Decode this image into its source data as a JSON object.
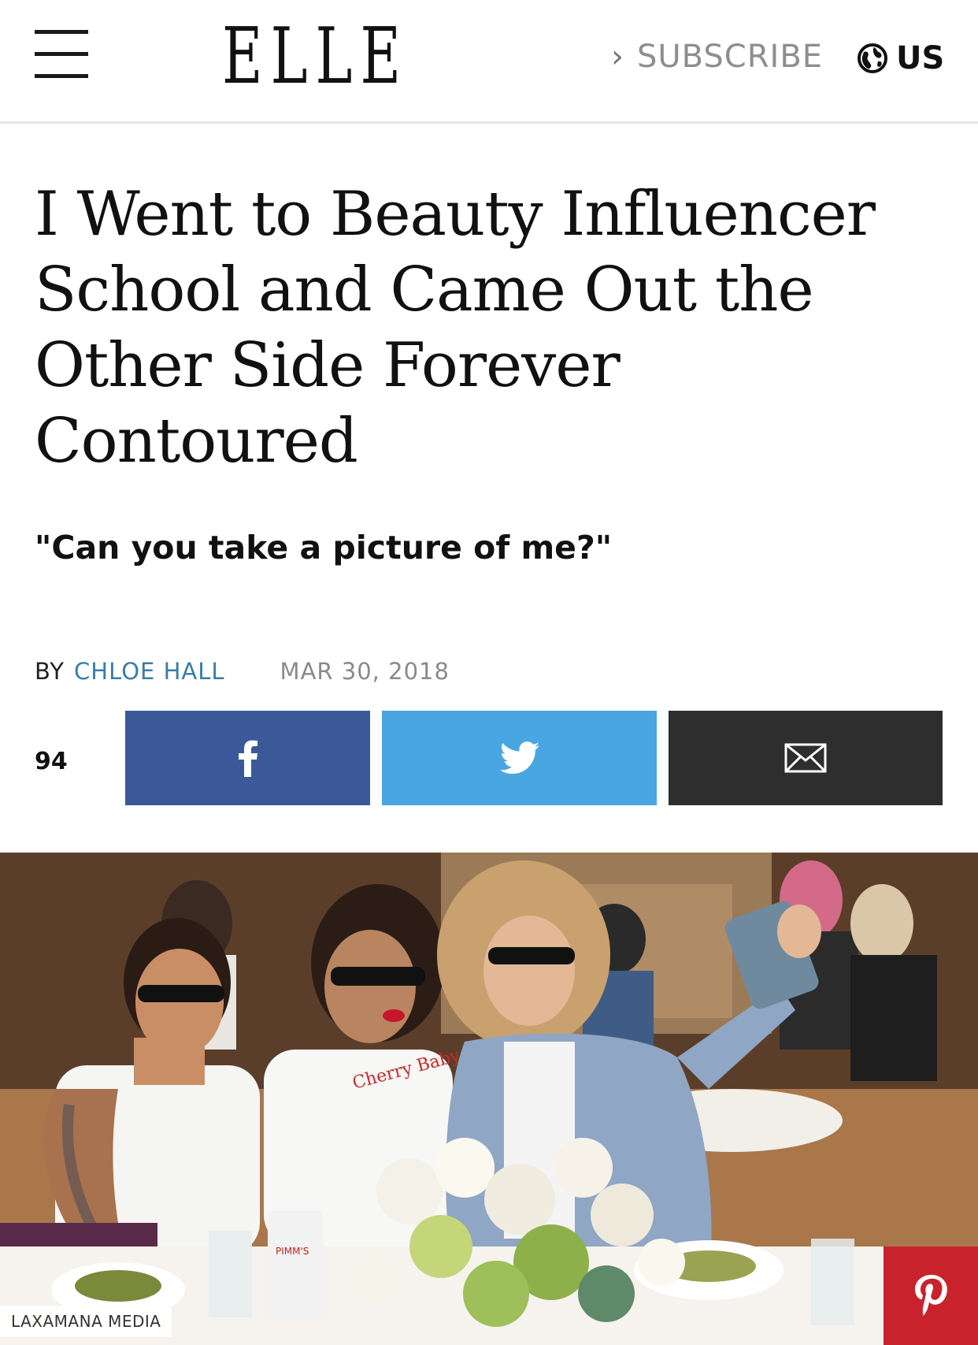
{
  "header": {
    "logo_text": "ELLE",
    "subscribe_label": "SUBSCRIBE",
    "region_label": "US",
    "icons": {
      "menu": "hamburger-icon",
      "chevron": "chevron-right-icon",
      "globe": "globe-icon"
    }
  },
  "article": {
    "headline": "I Went to Beauty Influencer School and Came Out the Other Side Forever Contoured",
    "dek": "\"Can you take a picture of me?\"",
    "byline_prefix": "BY",
    "author": "CHLOE HALL",
    "date": "MAR 30, 2018"
  },
  "share": {
    "count": "94",
    "buttons": [
      {
        "network": "facebook",
        "icon": "facebook-icon",
        "color": "#3b5998"
      },
      {
        "network": "twitter",
        "icon": "twitter-icon",
        "color": "#4aa6e2"
      },
      {
        "network": "email",
        "icon": "mail-icon",
        "color": "#2e2e2e"
      }
    ]
  },
  "hero": {
    "photo_credit": "LAXAMANA MEDIA",
    "shirt_text": "Cherry Baby",
    "cup_text": "PIMM'S",
    "pin_icon": "pinterest-icon",
    "pin_color": "#c8232c"
  },
  "colors": {
    "author_link": "#3a7ca5",
    "date_gray": "#8a8a8a",
    "subscribe_gray": "#8e8e8e"
  }
}
